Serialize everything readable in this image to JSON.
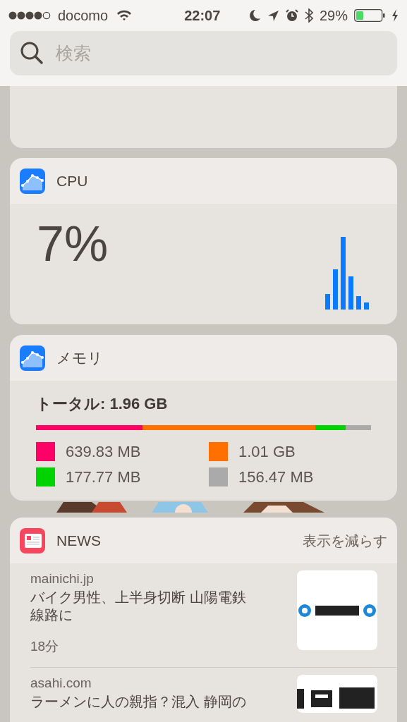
{
  "status_bar": {
    "carrier": "docomo",
    "time": "22:07",
    "battery": "29%"
  },
  "search": {
    "placeholder": "検索"
  },
  "widgets": [
    {
      "kind": "blank"
    },
    {
      "kind": "cpu",
      "title": "CPU",
      "value": "7%"
    },
    {
      "kind": "memory",
      "title": "メモリ",
      "total": "トータル: 1.96 GB",
      "segments": [
        {
          "color": "#ff0066",
          "value": "639.83 MB"
        },
        {
          "color": "#ff7000",
          "value": "1.01 GB"
        },
        {
          "color": "#00d400",
          "value": "177.77 MB"
        },
        {
          "color": "#aaaaaa",
          "value": "156.47 MB"
        }
      ]
    },
    {
      "kind": "news",
      "title": "NEWS",
      "action": "表示を減らす",
      "items": [
        {
          "source": "mainichi.jp",
          "headline": "バイク男性、上半身切断 山陽電鉄線路に",
          "time": "18分"
        },
        {
          "source": "asahi.com",
          "headline": "ラーメンに人の親指？混入 静岡の"
        }
      ]
    }
  ]
}
